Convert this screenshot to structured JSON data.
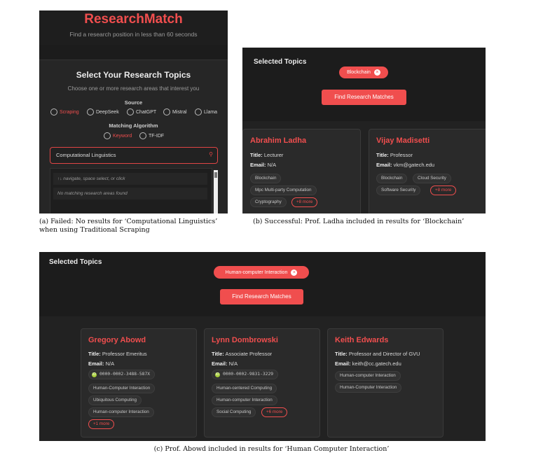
{
  "panel_a": {
    "brand": "ResearchMatch",
    "tagline": "Find a research position in less than 60 seconds",
    "heading": "Select Your Research Topics",
    "subheading": "Choose one or more research areas that interest you",
    "source_label": "Source",
    "sources": [
      "Scraping",
      "DeepSeek",
      "ChatGPT",
      "Mistral",
      "Llama"
    ],
    "selected_source": "Scraping",
    "algorithm_label": "Matching Algorithm",
    "algorithms": [
      "Keyword",
      "TF-IDF"
    ],
    "selected_algorithm": "Keyword",
    "search_value": "Computational Linguistics",
    "search_icon": "search-icon",
    "dropdown_hint": "↑↓ navigate, space select, or click",
    "dropdown_empty": "No matching research areas found",
    "caption": "(a) Failed: No results for ‘Computational Linguistics’ when using Traditional Scraping"
  },
  "panel_b": {
    "title": "Selected Topics",
    "chip": "Blockchain",
    "button": "Find Research Matches",
    "cards": [
      {
        "name": "Abrahim Ladha",
        "title_label": "Title:",
        "title": "Lecturer",
        "email_label": "Email:",
        "email": "N/A",
        "tags": [
          "Blockchain",
          "Mpc Multi-party Computation",
          "Cryptography"
        ],
        "more": "+8 more"
      },
      {
        "name": "Vijay Madisetti",
        "title_label": "Title:",
        "title": "Professor",
        "email_label": "Email:",
        "email": "vkm@gatech.edu",
        "tags": [
          "Blockchain",
          "Cloud Security",
          "Software Security"
        ],
        "more": "+8 more"
      }
    ],
    "caption": "(b) Successful: Prof. Ladha included in results for ‘Blockchain’"
  },
  "panel_c": {
    "title": "Selected Topics",
    "chip": "Human-computer Interaction",
    "button": "Find Research Matches",
    "cards": [
      {
        "name": "Gregory Abowd",
        "title_label": "Title:",
        "title": "Professor Emeritus",
        "email_label": "Email:",
        "email": "N/A",
        "orcid": "0000-0002-3488-587X",
        "tags": [
          "Human-Computer Interaction",
          "Ubiquitous Computing",
          "Human-computer Interaction"
        ],
        "more": "+1 more"
      },
      {
        "name": "Lynn Dombrowski",
        "title_label": "Title:",
        "title": "Associate Professor",
        "email_label": "Email:",
        "email": "N/A",
        "orcid": "0000-0002-9831-3229",
        "tags": [
          "Human-centered Computing",
          "Human-computer Interaction",
          "Social Computing"
        ],
        "more": "+6 more"
      },
      {
        "name": "Keith Edwards",
        "title_label": "Title:",
        "title": "Professor and Director of GVU",
        "email_label": "Email:",
        "email": "keith@cc.gatech.edu",
        "tags": [
          "Human-computer Interaction",
          "Human-Computer Interaction"
        ]
      }
    ],
    "caption": "(c) Prof. Abowd included in results for ‘Human Computer Interaction’"
  },
  "colors": {
    "accent": "#f04e4e",
    "background": "#1c1c1c",
    "card": "#2a2a2a",
    "orcid": "#a6ce39"
  }
}
